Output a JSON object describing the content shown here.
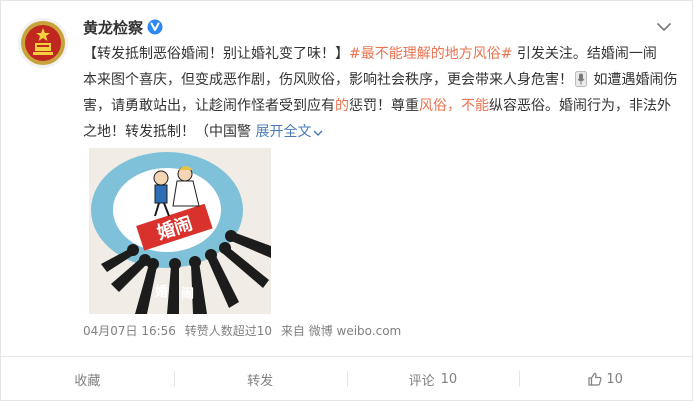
{
  "author": {
    "name": "黄龙检察",
    "avatar_icon": "procuratorate-emblem-icon",
    "verified_icon": "verified-badge-icon"
  },
  "post": {
    "line1": {
      "title": "【转发抵制恶俗婚闹！别让婚礼变了味！】",
      "hashtag": "#最不能理解的地方风俗#",
      "tail": " 引发关注。结婚闹一闹"
    },
    "line2": {
      "text": "本来图个喜庆，但变成恶作剧，伤风败俗，影响社会秩序，更会带来人身危害！",
      "mic_icon": "microphone-icon",
      "tail": " 如遭遇婚闹伤"
    },
    "line3": {
      "a": "害，请勇敢站出，让趁闹作怪者受到应有",
      "b": "的",
      "c": "惩罚！尊重",
      "d": "风俗",
      "e": "，",
      "f": "不能",
      "g": "纵容恶俗。婚闹行为，非法外"
    },
    "line4": {
      "text": "之地！转发抵制！（中国警 ",
      "expand": "展开全文",
      "expand_icon": "chevron-down-icon"
    }
  },
  "image": {
    "banner": "婚闹",
    "label_left": "婚",
    "label_right": "闹"
  },
  "meta": {
    "date": "04月07日 16:56",
    "reposts": "转赞人数超过10",
    "source": "来自 微博 weibo.com"
  },
  "actions": {
    "favorite": "收藏",
    "repost": "转发",
    "comment": "评论",
    "comment_count": "10",
    "like_count": "10"
  },
  "colors": {
    "link_orange": "#eb7350",
    "link_blue": "#4a7bb7",
    "text": "#333333",
    "meta": "#808080"
  }
}
